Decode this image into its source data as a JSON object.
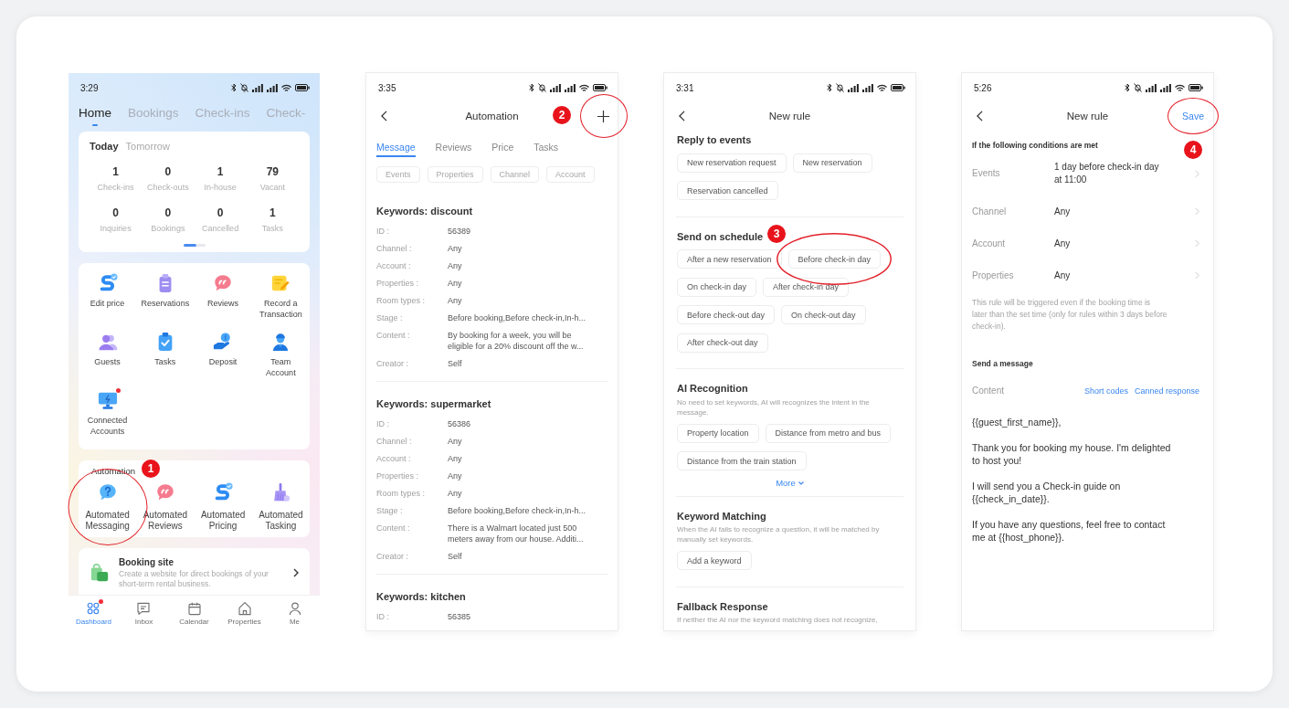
{
  "home": {
    "status_time": "3:29",
    "tabs": [
      {
        "label": "Home",
        "selected": true
      },
      {
        "label": "Bookings",
        "selected": false
      },
      {
        "label": "Check-ins",
        "selected": false
      },
      {
        "label": "Check-",
        "selected": false
      }
    ],
    "summary": {
      "periods": [
        {
          "label": "Today",
          "selected": true
        },
        {
          "label": "Tomorrow",
          "selected": false
        }
      ],
      "stats": [
        {
          "value": "1",
          "label": "Check-ins"
        },
        {
          "value": "0",
          "label": "Check-outs"
        },
        {
          "value": "1",
          "label": "In-house"
        },
        {
          "value": "79",
          "label": "Vacant"
        },
        {
          "value": "0",
          "label": "Inquiries"
        },
        {
          "value": "0",
          "label": "Bookings"
        },
        {
          "value": "0",
          "label": "Cancelled"
        },
        {
          "value": "1",
          "label": "Tasks"
        }
      ],
      "pages": [
        {
          "selected": true
        },
        {
          "selected": false
        }
      ]
    },
    "shortcuts": [
      {
        "label": "Edit price",
        "badge": false
      },
      {
        "label": "Reservations",
        "badge": false
      },
      {
        "label": "Reviews",
        "badge": false
      },
      {
        "label": "Record a Transaction",
        "badge": false
      },
      {
        "label": "Guests",
        "badge": false
      },
      {
        "label": "Tasks",
        "badge": false
      },
      {
        "label": "Deposit",
        "badge": false
      },
      {
        "label": "Team Account",
        "badge": false
      },
      {
        "label": "Connected Accounts",
        "badge": true
      }
    ],
    "automation": {
      "title": "Automation",
      "items": [
        {
          "label": "Automated Messaging",
          "circled": true
        },
        {
          "label": "Automated Reviews",
          "circled": false
        },
        {
          "label": "Automated Pricing",
          "circled": false
        },
        {
          "label": "Automated Tasking",
          "circled": false
        }
      ]
    },
    "booking_site": {
      "title": "Booking site",
      "description": "Create a website for direct bookings of your short-term rental business."
    },
    "nav": [
      {
        "label": "Dashboard",
        "selected": true,
        "badge": true
      },
      {
        "label": "Inbox",
        "selected": false,
        "badge": false
      },
      {
        "label": "Calendar",
        "selected": false,
        "badge": false
      },
      {
        "label": "Properties",
        "selected": false,
        "badge": false
      },
      {
        "label": "Me",
        "selected": false,
        "badge": false
      }
    ],
    "callout": "1"
  },
  "automation_list": {
    "status_time": "3:35",
    "title": "Automation",
    "add_button": {
      "circled": true
    },
    "tabs": [
      {
        "label": "Message",
        "selected": true
      },
      {
        "label": "Reviews",
        "selected": false
      },
      {
        "label": "Price",
        "selected": false
      },
      {
        "label": "Tasks",
        "selected": false
      }
    ],
    "filters": [
      "Events",
      "Properties",
      "Channel",
      "Account"
    ],
    "rules": [
      {
        "title": "Keywords: discount",
        "fields": [
          {
            "label": "ID :",
            "value": "56389"
          },
          {
            "label": "Channel :",
            "value": "Any"
          },
          {
            "label": "Account :",
            "value": "Any"
          },
          {
            "label": "Properties :",
            "value": "Any"
          },
          {
            "label": "Room types :",
            "value": "Any"
          },
          {
            "label": "Stage :",
            "value": "Before booking,Before check-in,In-h..."
          },
          {
            "label": "Content :",
            "value": "By booking for a week, you will be eligible for a 20% discount off the w..."
          },
          {
            "label": "Creator :",
            "value": "Self"
          }
        ]
      },
      {
        "title": "Keywords: supermarket",
        "fields": [
          {
            "label": "ID :",
            "value": "56386"
          },
          {
            "label": "Channel :",
            "value": "Any"
          },
          {
            "label": "Account :",
            "value": "Any"
          },
          {
            "label": "Properties :",
            "value": "Any"
          },
          {
            "label": "Room types :",
            "value": "Any"
          },
          {
            "label": "Stage :",
            "value": "Before booking,Before check-in,In-h..."
          },
          {
            "label": "Content :",
            "value": "There is a Walmart located just 500 meters away from our house. Additi..."
          },
          {
            "label": "Creator :",
            "value": "Self"
          }
        ]
      },
      {
        "title": "Keywords: kitchen",
        "fields": [
          {
            "label": "ID :",
            "value": "56385"
          }
        ]
      }
    ],
    "callout": "2"
  },
  "rule_types": {
    "status_time": "3:31",
    "title": "New rule",
    "sections": [
      {
        "title": "Reply to events",
        "options": [
          {
            "label": "New reservation request",
            "circled": false
          },
          {
            "label": "New reservation",
            "circled": false
          },
          {
            "label": "Reservation cancelled",
            "circled": false
          }
        ]
      },
      {
        "title": "Send on schedule",
        "options": [
          {
            "label": "After a new reservation",
            "circled": false
          },
          {
            "label": "Before check-in day",
            "circled": true
          },
          {
            "label": "On check-in day",
            "circled": false
          },
          {
            "label": "After check-in day",
            "circled": false
          },
          {
            "label": "Before check-out day",
            "circled": false
          },
          {
            "label": "On check-out day",
            "circled": false
          },
          {
            "label": "After check-out day",
            "circled": false
          }
        ]
      },
      {
        "title": "AI Recognition",
        "description": "No need to set keywords, AI will recognizes the intent in the message.",
        "options": [
          {
            "label": "Property location",
            "circled": false
          },
          {
            "label": "Distance from metro and bus",
            "circled": false
          },
          {
            "label": "Distance from the train station",
            "circled": false
          }
        ],
        "more": "More"
      },
      {
        "title": "Keyword Matching",
        "description": "When the AI fails to recognize a question, it will be matched by manually set keywords.",
        "options": [
          {
            "label": "Add a keyword",
            "circled": false
          }
        ]
      },
      {
        "title": "Fallback Response",
        "description": "If neither the AI nor the keyword matching does not recognize,"
      }
    ],
    "callout": "3"
  },
  "rule_form": {
    "status_time": "5:26",
    "title": "New rule",
    "save": {
      "label": "Save",
      "circled": true
    },
    "conditions_title": "If the following conditions are met",
    "conditions": [
      {
        "label": "Events",
        "value": "1 day before check-in day at 11:00"
      },
      {
        "label": "Channel",
        "value": "Any"
      },
      {
        "label": "Account",
        "value": "Any"
      },
      {
        "label": "Properties",
        "value": "Any"
      }
    ],
    "note": "This rule will be triggered even if the booking time is later than the set time (only for rules within 3 days before check-in).",
    "message_title": "Send a message",
    "content_label": "Content",
    "content_links": [
      "Short codes",
      "Canned response"
    ],
    "message": [
      "{{guest_first_name}},",
      "Thank you for booking my house. I'm delighted to host you!",
      "I will send you a Check-in guide on {{check_in_date}}.",
      "If you have any questions, feel free to contact me at {{host_phone}}."
    ],
    "callout": "4"
  }
}
